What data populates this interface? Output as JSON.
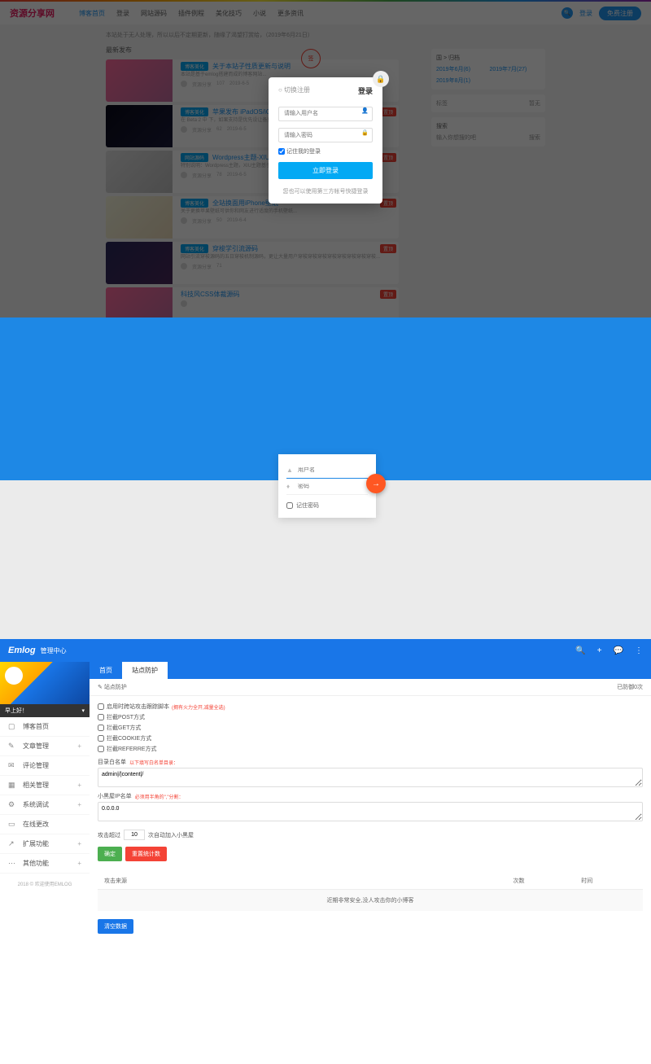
{
  "s1": {
    "logo": "资源分享网",
    "nav": [
      "博客首页",
      "登录",
      "网站源码",
      "插件例程",
      "美化技巧",
      "小说",
      "更多资讯"
    ],
    "search_login": "登录",
    "register": "免费注册",
    "notice": "本站处于无人处理，所以以后不定期更新，随缘了渴望打赏给，（2019年6月21日）",
    "latest": "最新发布",
    "posts": [
      {
        "cat": "博客美化",
        "title": "关于本站子性质更新与说明",
        "desc": "本站是基于emlog搭建而成的博客网站...",
        "badge": "",
        "meta": [
          "资源分享",
          "107",
          "2019-6-5"
        ]
      },
      {
        "cat": "博客美化",
        "title": "苹果发布 iPadOS/iOS13",
        "desc": "在 Beta 2 中 下，如果支持是优先设让备更多发布设备中推动一起...",
        "badge": "置顶",
        "meta": [
          "资源分享",
          "62",
          "2019-6-5"
        ]
      },
      {
        "cat": "网站源码",
        "title": "Wordpress主题-XIU主题",
        "desc": "特别说明：Wordpress主题，XIU主题基于阿里百秀XIU主题制作程序...",
        "badge": "置顶",
        "meta": [
          "资源分享",
          "78",
          "2019-6-5"
        ]
      },
      {
        "cat": "博客美化",
        "title": "全站换面用iPhone壁纸",
        "desc": "关于更换苹果壁纸可供你和网友进行适度的手机壁纸...",
        "badge": "置顶",
        "meta": [
          "资源分享",
          "50",
          "2019-6-4"
        ]
      },
      {
        "cat": "博客美化",
        "title": "穿梭学引流源码",
        "desc": "网站引流穿梭源码的五日穿梭机制源码，更让大量用户穿梭穿梭穿梭穿梭穿梭穿梭穿梭穿梭...",
        "badge": "置顶",
        "meta": [
          "资源分享",
          "71"
        ]
      },
      {
        "cat": "",
        "title": "科技风CSS体裁源码",
        "desc": "",
        "badge": "置顶",
        "meta": []
      }
    ],
    "sidebar": {
      "archive_title": "国 > 归档",
      "dates": [
        "2019年6月(6)",
        "2019年7月(27)",
        "2019年8月(1)"
      ],
      "tags_title": "标签",
      "tags_empty": "暂无",
      "search_title": "搜索",
      "search_placeholder": "输入你想搜的吧",
      "search_btn": "搜索"
    },
    "icon_right": "签",
    "modal": {
      "tab1": "○ 切换注册",
      "tab2": "登录",
      "username_ph": "请输入用户名",
      "password_ph": "请输入密码",
      "remember": "记住我的登录",
      "submit": "立即登录",
      "social": "您也可以使用第三方帐号快捷登录"
    }
  },
  "s2": {
    "username_ph": "用户名",
    "password_ph": "密码",
    "remember": "记住密码"
  },
  "s3": {
    "brand": "Emlog",
    "brand_sub": "管理中心",
    "topbar_icons": [
      "search",
      "add",
      "chat",
      "more"
    ],
    "greeting": "早上好！",
    "menu": [
      {
        "icon": "▢",
        "label": "博客首页",
        "plus": false
      },
      {
        "icon": "✎",
        "label": "文章管理",
        "plus": true
      },
      {
        "icon": "✉",
        "label": "评论管理",
        "plus": false
      },
      {
        "icon": "▦",
        "label": "相关管理",
        "plus": true
      },
      {
        "icon": "⚙",
        "label": "系统调试",
        "plus": true
      },
      {
        "icon": "▭",
        "label": "在线更改",
        "plus": false
      },
      {
        "icon": "↗",
        "label": "扩展功能",
        "plus": true
      },
      {
        "icon": "⋯",
        "label": "其他功能",
        "plus": true
      }
    ],
    "footer": "2018 © 欢迎使用EMLOG",
    "tabs": [
      "首页",
      "站点防护"
    ],
    "panel_title": "站点防护",
    "panel_right": "已防御0次",
    "checks": [
      {
        "label": "启用时跨站攻击跟踪脚本",
        "hint": "(拥有火力全开,减量全选)"
      },
      {
        "label": "拦截POST方式",
        "hint": ""
      },
      {
        "label": "拦截GET方式",
        "hint": ""
      },
      {
        "label": "拦截COOKIE方式",
        "hint": ""
      },
      {
        "label": "拦截REFERRE方式",
        "hint": ""
      }
    ],
    "whitelist_label": "目录白名单",
    "whitelist_hint": "以下填写白名单目录：",
    "whitelist_value": "admin|/|content|/",
    "blackip_label": "小黑屋IP名单",
    "blackip_hint": "必须用半角的\",\"分割：",
    "blackip_value": "0.0.0.0",
    "count_prefix": "攻击超过",
    "count_value": "10",
    "count_suffix": "次自动加入小黑屋",
    "btn_confirm": "确定",
    "btn_reset": "重置统计数",
    "table_headers": [
      "攻击来源",
      "次数",
      "时间"
    ],
    "table_empty": "近期非常安全,没人攻击你的小博客",
    "btn_clear": "清空数据"
  }
}
